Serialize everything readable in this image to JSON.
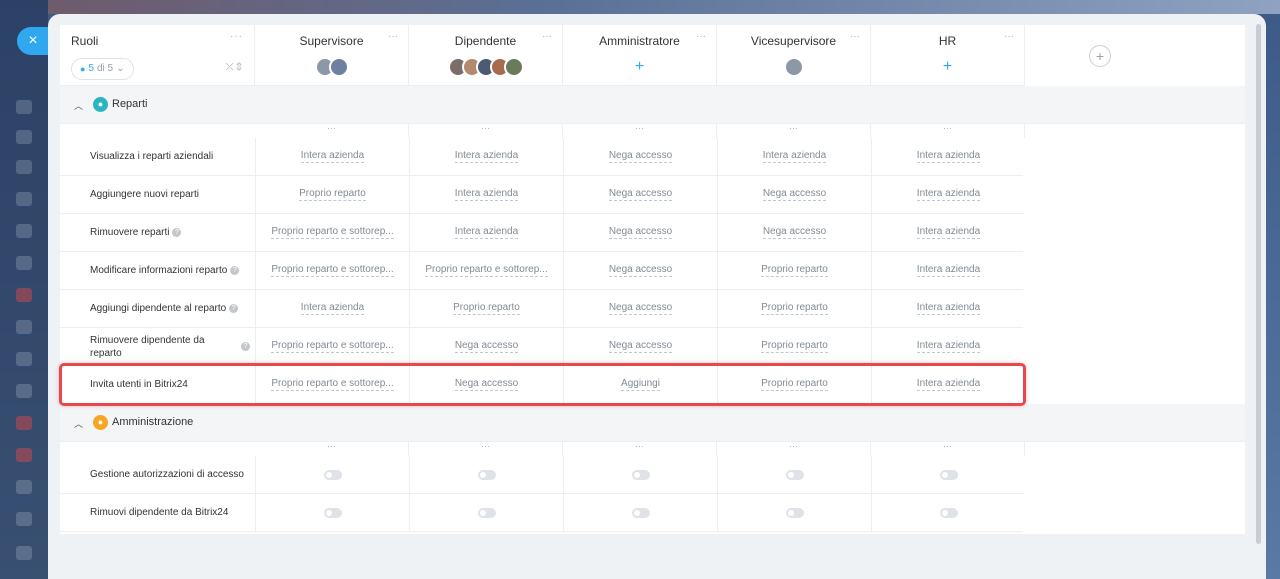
{
  "close_label": "×",
  "header": {
    "roles_title": "Ruoli",
    "counter_current": "5",
    "counter_suffix": "di 5",
    "menu_dots": "···",
    "add_symbol": "+",
    "roles": [
      {
        "name": "Supervisore",
        "avatars": [
          "#8d98a6",
          "#6e7fa0"
        ]
      },
      {
        "name": "Dipendente",
        "avatars": [
          "#7b6e68",
          "#b28a6d",
          "#4d5a73",
          "#a86b4f",
          "#6a7b5c"
        ]
      },
      {
        "name": "Amministratore",
        "avatars": []
      },
      {
        "name": "Vicesupervisore",
        "avatars": [
          "#8d98a6"
        ]
      },
      {
        "name": "HR",
        "avatars": []
      }
    ]
  },
  "sections": [
    {
      "name": "Reparti",
      "icon": "group-icon",
      "color": "#2bb5c2",
      "rows": [
        {
          "label": "Visualizza i reparti aziendali",
          "help": false,
          "values": [
            "Intera azienda",
            "Intera azienda",
            "Nega accesso",
            "Intera azienda",
            "Intera azienda"
          ]
        },
        {
          "label": "Aggiungere nuovi reparti",
          "help": false,
          "values": [
            "Proprio reparto",
            "Intera azienda",
            "Nega accesso",
            "Nega accesso",
            "Intera azienda"
          ]
        },
        {
          "label": "Rimuovere reparti",
          "help": true,
          "values": [
            "Proprio reparto e sottorep...",
            "Intera azienda",
            "Nega accesso",
            "Nega accesso",
            "Intera azienda"
          ]
        },
        {
          "label": "Modificare informazioni reparto",
          "help": true,
          "values": [
            "Proprio reparto e sottorep...",
            "Proprio reparto e sottorep...",
            "Nega accesso",
            "Proprio reparto",
            "Intera azienda"
          ]
        },
        {
          "label": "Aggiungi dipendente al reparto",
          "help": true,
          "values": [
            "Intera azienda",
            "Proprio reparto",
            "Nega accesso",
            "Proprio reparto",
            "Intera azienda"
          ]
        },
        {
          "label": "Rimuovere dipendente da reparto",
          "help": true,
          "values": [
            "Proprio reparto e sottorep...",
            "Nega accesso",
            "Nega accesso",
            "Proprio reparto",
            "Intera azienda"
          ]
        },
        {
          "label": "Invita utenti in Bitrix24",
          "help": false,
          "values": [
            "Proprio reparto e sottorep...",
            "Nega accesso",
            "Aggiungi",
            "Proprio reparto",
            "Intera azienda"
          ],
          "highlighted": true
        }
      ]
    },
    {
      "name": "Amministrazione",
      "icon": "user-icon",
      "color": "#f5a623",
      "rows": [
        {
          "label": "Gestione autorizzazioni di accesso",
          "toggles": [
            false,
            false,
            false,
            false,
            false
          ]
        },
        {
          "label": "Rimuovi dipendente da Bitrix24",
          "toggles": [
            false,
            false,
            false,
            false,
            false
          ]
        }
      ]
    }
  ]
}
